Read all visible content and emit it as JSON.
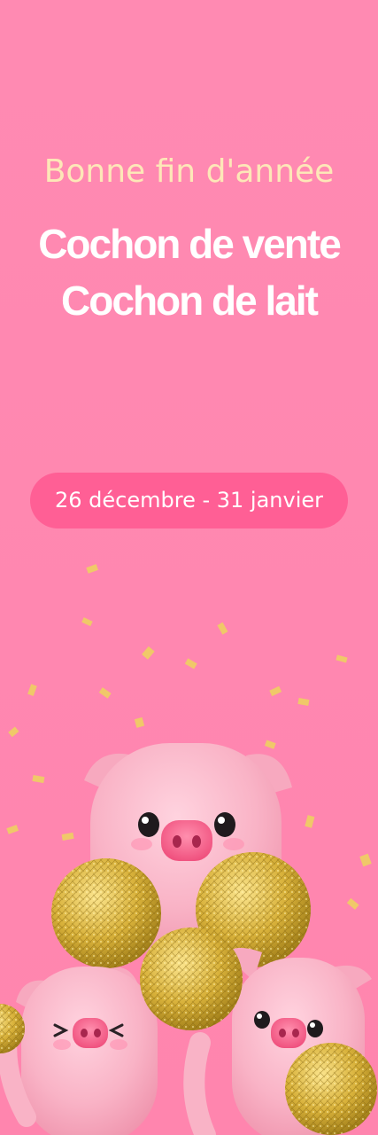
{
  "banner": {
    "subtitle": "Bonne fin d'année",
    "headline_line1": "Cochon de vente",
    "headline_line2": "Cochon de lait",
    "date_range": "26 décembre - 31 janvier"
  },
  "colors": {
    "background": "#ff89b1",
    "subtitle_text": "#fde7b8",
    "headline_text": "#ffffff",
    "pill_background": "#ff5f95",
    "pig_pink": "#f9b5c8",
    "pompom_gold": "#d9b535",
    "confetti_gold": "#f0c869"
  },
  "illustration": {
    "subject": "three pink piglets with gold pompoms and falling confetti"
  }
}
